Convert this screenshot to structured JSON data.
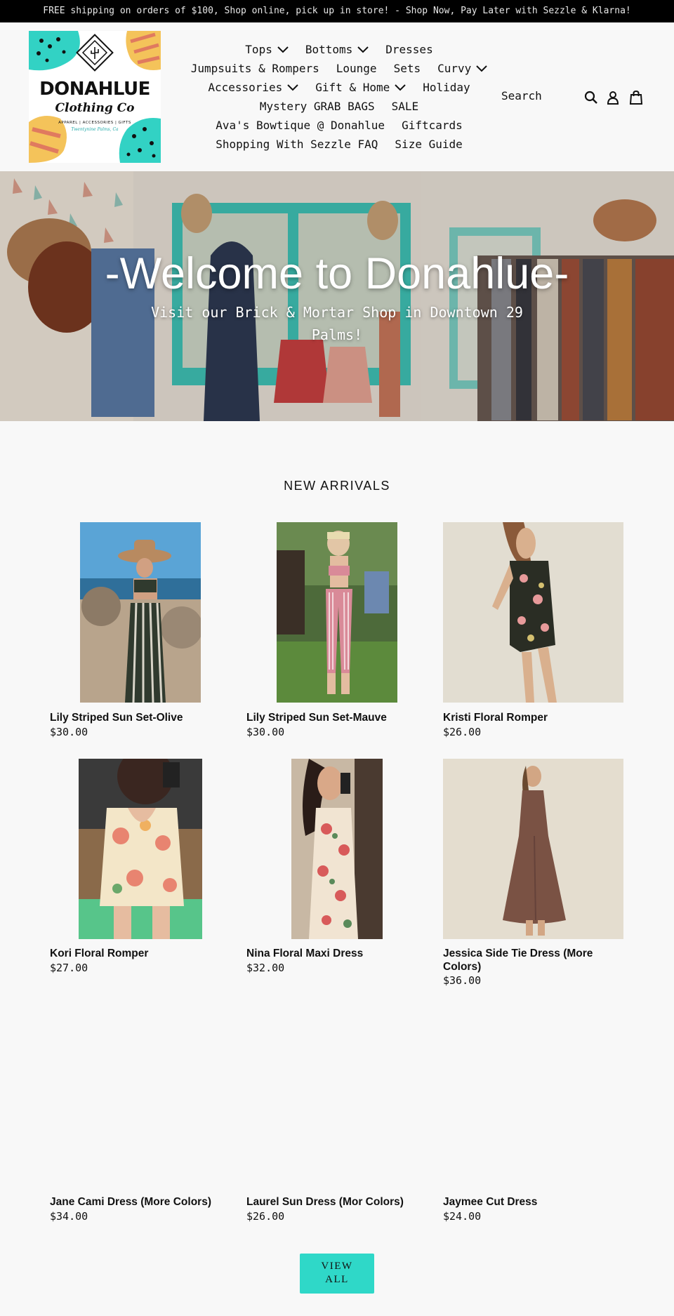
{
  "announcement": "FREE shipping on orders of $100, Shop online, pick up in store! - Shop Now, Pay Later with Sezzle & Klarna!",
  "logo": {
    "line1": "DONAHLUE",
    "line2": "Clothing Co",
    "line3": "APPAREL | ACCESSORIES | GIFTS",
    "line4": "Twentynine Palms, Ca"
  },
  "nav": {
    "row1": [
      {
        "label": "Tops",
        "dropdown": true
      },
      {
        "label": "Bottoms",
        "dropdown": true
      },
      {
        "label": "Dresses",
        "dropdown": false
      }
    ],
    "row2": [
      {
        "label": "Jumpsuits & Rompers",
        "dropdown": false
      },
      {
        "label": "Lounge",
        "dropdown": false
      },
      {
        "label": "Sets",
        "dropdown": false
      },
      {
        "label": "Curvy",
        "dropdown": true
      }
    ],
    "row3": [
      {
        "label": "Accessories",
        "dropdown": true
      },
      {
        "label": "Gift & Home",
        "dropdown": true
      },
      {
        "label": "Holiday",
        "dropdown": false
      }
    ],
    "row4": [
      {
        "label": "Mystery GRAB BAGS",
        "dropdown": false
      },
      {
        "label": "SALE",
        "dropdown": false
      }
    ],
    "row5": [
      {
        "label": "Ava's Bowtique @ Donahlue",
        "dropdown": false
      },
      {
        "label": "Giftcards",
        "dropdown": false
      }
    ],
    "row6": [
      {
        "label": "Shopping With Sezzle FAQ",
        "dropdown": false
      },
      {
        "label": "Size Guide",
        "dropdown": false
      }
    ]
  },
  "header": {
    "search_label": "Search",
    "icons": [
      "search-icon",
      "account-icon",
      "cart-icon"
    ]
  },
  "hero": {
    "title": "-Welcome to Donahlue-",
    "subtitle": "Visit our Brick & Mortar Shop in Downtown 29 Palms!"
  },
  "new_arrivals": {
    "title": "NEW ARRIVALS",
    "products": [
      {
        "name": "Lily Striped Sun Set-Olive",
        "price": "$30.00"
      },
      {
        "name": "Lily Striped Sun Set-Mauve",
        "price": "$30.00"
      },
      {
        "name": "Kristi Floral Romper",
        "price": "$26.00"
      },
      {
        "name": "Kori Floral Romper",
        "price": "$27.00"
      },
      {
        "name": "Nina Floral Maxi Dress",
        "price": "$32.00"
      },
      {
        "name": "Jessica Side Tie Dress (More Colors)",
        "price": "$36.00"
      },
      {
        "name": "Jane Cami Dress (More Colors)",
        "price": "$34.00"
      },
      {
        "name": "Laurel Sun Dress (Mor Colors)",
        "price": "$26.00"
      },
      {
        "name": "Jaymee Cut Dress",
        "price": "$24.00"
      }
    ],
    "view_all_line1": "VIEW",
    "view_all_line2": "ALL"
  },
  "colors": {
    "announcement_bg": "#000000",
    "accent": "#2fd8c8",
    "background": "#f8f8f8"
  }
}
